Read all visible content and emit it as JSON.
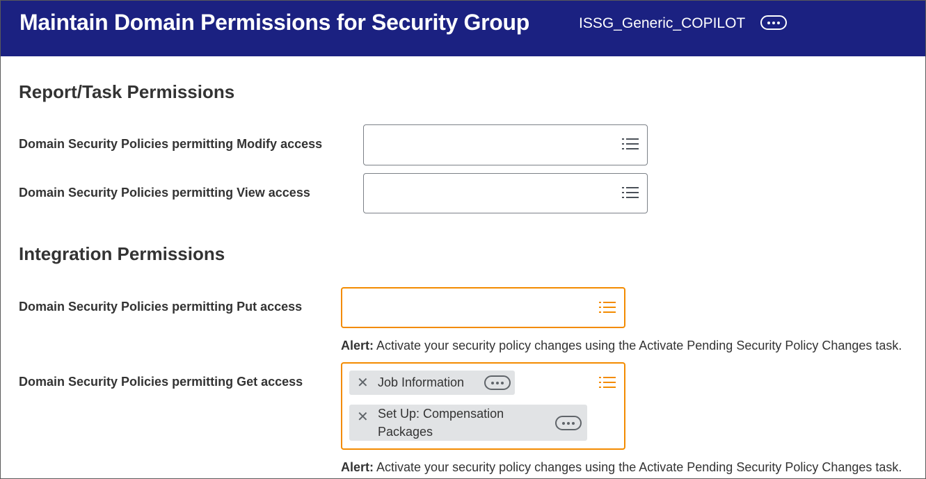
{
  "header": {
    "title": "Maintain Domain Permissions for Security Group",
    "security_group": "ISSG_Generic_COPILOT",
    "more_icon": "ellipsis-icon"
  },
  "report_task": {
    "title": "Report/Task Permissions",
    "modify_label": "Domain Security Policies permitting Modify access",
    "view_label": "Domain Security Policies permitting View access"
  },
  "integration": {
    "title": "Integration Permissions",
    "put_label": "Domain Security Policies permitting Put access",
    "get_label": "Domain Security Policies permitting Get access",
    "alert_prefix": "Alert:",
    "alert_text": " Activate your security policy changes using the Activate Pending Security Policy Changes task.",
    "get_selections": [
      {
        "line1": "Job Information",
        "line2": ""
      },
      {
        "line1": "Set Up: Compensation",
        "line2": "Packages"
      }
    ]
  },
  "colors": {
    "header_bg": "#1b2181",
    "alert_border": "#f38b00",
    "pill_bg": "#e1e3e5"
  },
  "icons": {
    "prompt_list": "list-icon",
    "remove": "close-icon",
    "related_actions": "ellipsis-icon"
  }
}
